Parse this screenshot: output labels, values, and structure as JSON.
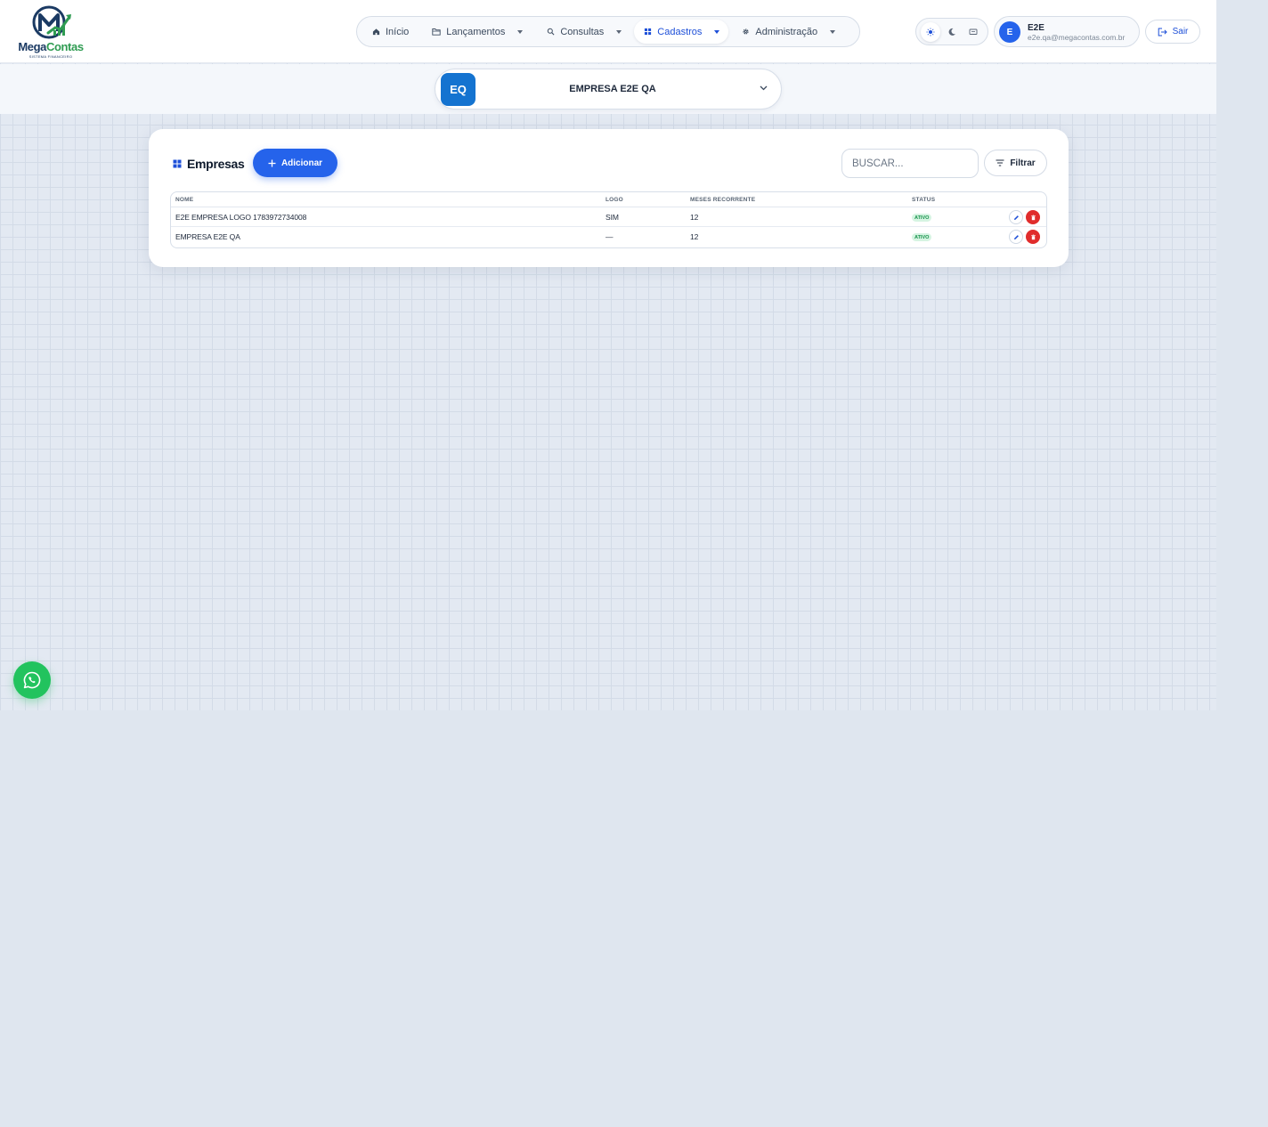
{
  "brand": {
    "name_part1": "Mega",
    "name_part2": "Contas",
    "tagline": "SISTEMA FINANCEIRO",
    "colors": {
      "navy": "#1b3a63",
      "green": "#2f9c52"
    }
  },
  "nav": {
    "items": [
      {
        "label": "Início",
        "icon": "home-icon",
        "has_caret": false,
        "active": false
      },
      {
        "label": "Lançamentos",
        "icon": "folder-icon",
        "has_caret": true,
        "active": false
      },
      {
        "label": "Consultas",
        "icon": "search-icon",
        "has_caret": true,
        "active": false
      },
      {
        "label": "Cadastros",
        "icon": "grid-icon",
        "has_caret": true,
        "active": true
      },
      {
        "label": "Administração",
        "icon": "gear-icon",
        "has_caret": true,
        "active": false
      }
    ]
  },
  "theme": {
    "options": [
      "sun-icon",
      "moon-icon",
      "monitor-icon"
    ],
    "active": "sun-icon"
  },
  "user": {
    "initial": "E",
    "name": "E2E",
    "email": "e2e.qa@megacontas.com.br"
  },
  "logout_label": "Sair",
  "company": {
    "badge": "EQ",
    "name": "EMPRESA E2E QA"
  },
  "page": {
    "title": "Empresas",
    "add_label": "Adicionar",
    "search_placeholder": "BUSCAR...",
    "filter_label": "Filtrar"
  },
  "table": {
    "columns": [
      "NOME",
      "LOGO",
      "MESES RECORRENTE",
      "STATUS"
    ],
    "rows": [
      {
        "nome": "E2E EMPRESA LOGO 1783972734008",
        "logo": "SIM",
        "meses": "12",
        "status": "ATIVO"
      },
      {
        "nome": "EMPRESA E2E QA",
        "logo": "—",
        "meses": "12",
        "status": "ATIVO"
      }
    ]
  },
  "colors": {
    "accent": "#2563eb",
    "company_badge": "#1473d0",
    "danger": "#e02c2c",
    "success": "#15924a",
    "whatsapp": "#22c35e"
  }
}
